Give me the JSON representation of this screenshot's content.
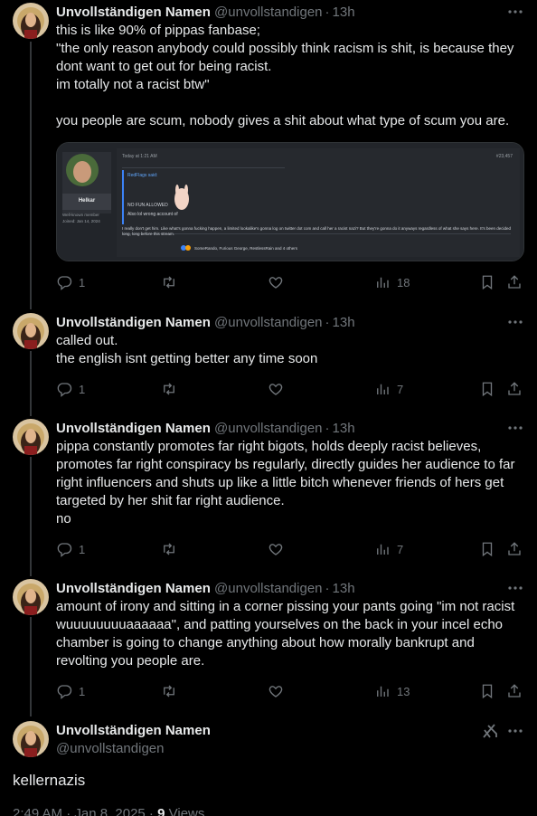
{
  "tweets": [
    {
      "name": "Unvollständigen Namen",
      "handle": "@unvollstandigen",
      "sep": "·",
      "time": "13h",
      "text": "this is like 90% of pippas fanbase;\n\"the only reason anybody could possibly think racism is shit, is because they dont want to get out for being racist.\nim totally not a racist btw\"\n\nyou people are scum, nobody gives a shit about what type of scum you are.",
      "replies": "1",
      "retweets": "",
      "likes": "",
      "views": "18",
      "media": {
        "time_label": "Today at 1:21 AM",
        "post_number": "#23,457",
        "user_name": "Helkar",
        "user_rank": "Well-known member",
        "user_joined": "Joined: Jan 14, 2024",
        "quote_author": "RedFlags said:",
        "quote_line1": "NO FUN ALLOWED",
        "quote_line2": "Also lol wrong account of",
        "body": "I really don't get him. Like what's gonna fucking happen, a limited lookalike's gonna log on twitter dot com and call her a racist nazi? But they're gonna do it anyways regardless of what she says here. It's been decided long, long before this stream.",
        "reactions": "SomeRando, Furious George, RestlessRain and 4 others"
      }
    },
    {
      "name": "Unvollständigen Namen",
      "handle": "@unvollstandigen",
      "sep": "·",
      "time": "13h",
      "text": "called out.\nthe english isnt getting better any time soon",
      "replies": "1",
      "retweets": "",
      "likes": "",
      "views": "7"
    },
    {
      "name": "Unvollständigen Namen",
      "handle": "@unvollstandigen",
      "sep": "·",
      "time": "13h",
      "text": "pippa constantly promotes far right bigots, holds deeply racist believes, promotes far right conspiracy bs regularly, directly guides her audience to far right influencers and shuts up like a little bitch whenever friends of hers get targeted by her shit far right audience.\nno",
      "replies": "1",
      "retweets": "",
      "likes": "",
      "views": "7"
    },
    {
      "name": "Unvollständigen Namen",
      "handle": "@unvollstandigen",
      "sep": "·",
      "time": "13h",
      "text": "amount of irony and sitting in a corner pissing your pants going \"im not racist wuuuuuuuuaaaaaa\", and patting yourselves on the back in your incel echo chamber is going to change anything about how morally bankrupt and revolting you people are.",
      "replies": "1",
      "retweets": "",
      "likes": "",
      "views": "13"
    }
  ],
  "main": {
    "name": "Unvollständigen Namen",
    "handle": "@unvollstandigen",
    "text": "kellernazis",
    "timestamp": "2:49 AM · Jan 8, 2025 ·",
    "views_count": "9",
    "views_label": "Views"
  },
  "colors": {
    "background": "#000000",
    "text": "#e7e9ea",
    "secondary": "#71767b",
    "divider": "#2f3336"
  },
  "icons": [
    "more-icon",
    "reply-icon",
    "retweet-icon",
    "like-icon",
    "views-icon",
    "bookmark-icon",
    "share-icon",
    "grok-icon"
  ]
}
